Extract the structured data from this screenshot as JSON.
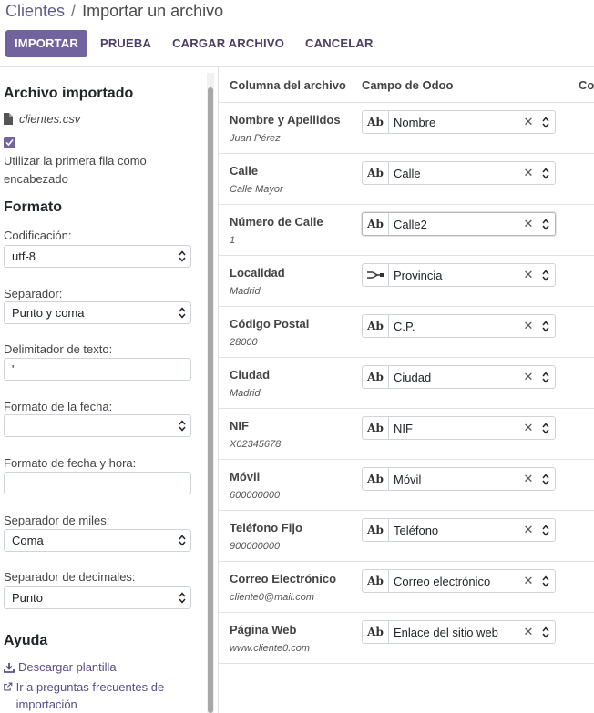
{
  "breadcrumb": {
    "parent": "Clientes",
    "separator": "/",
    "current": "Importar un archivo"
  },
  "toolbar": {
    "import": "IMPORTAR",
    "test": "PRUEBA",
    "load_file": "CARGAR ARCHIVO",
    "cancel": "CANCELAR"
  },
  "sidebar": {
    "imported_title": "Archivo importado",
    "file_name": "clientes.csv",
    "first_row_header_label": "Utilizar la primera fila como encabezado",
    "first_row_header_checked": true,
    "format_title": "Formato",
    "encoding_label": "Codificación:",
    "encoding_value": "utf-8",
    "separator_label": "Separador:",
    "separator_value": "Punto y coma",
    "text_delimiter_label": "Delimitador de texto:",
    "text_delimiter_value": "\"",
    "date_format_label": "Formato de la fecha:",
    "date_format_value": "",
    "datetime_format_label": "Formato de fecha y hora:",
    "datetime_format_value": "",
    "thousands_sep_label": "Separador de miles:",
    "thousands_sep_value": "Coma",
    "decimal_sep_label": "Separador de decimales:",
    "decimal_sep_value": "Punto",
    "help_title": "Ayuda",
    "download_template": "Descargar plantilla",
    "faq_link": "Ir a preguntas frecuentes de importación"
  },
  "table": {
    "headers": {
      "file_column": "Columna del archivo",
      "odoo_field": "Campo de Odoo",
      "comments": "Co"
    },
    "rows": [
      {
        "column": "Nombre y Apellidos",
        "sample": "Juan Pérez",
        "field": "Nombre",
        "type_icon": "text-type-icon",
        "type_label": "Ab"
      },
      {
        "column": "Calle",
        "sample": "Calle Mayor",
        "field": "Calle",
        "type_icon": "text-type-icon",
        "type_label": "Ab"
      },
      {
        "column": "Número de Calle",
        "sample": "1",
        "field": "Calle2",
        "type_icon": "text-type-icon",
        "type_label": "Ab",
        "focused": true
      },
      {
        "column": "Localidad",
        "sample": "Madrid",
        "field": "Provincia",
        "type_icon": "relation-type-icon",
        "type_label": ""
      },
      {
        "column": "Código Postal",
        "sample": "28000",
        "field": "C.P.",
        "type_icon": "text-type-icon",
        "type_label": "Ab"
      },
      {
        "column": "Ciudad",
        "sample": "Madrid",
        "field": "Ciudad",
        "type_icon": "text-type-icon",
        "type_label": "Ab"
      },
      {
        "column": "NIF",
        "sample": "X02345678",
        "field": "NIF",
        "type_icon": "text-type-icon",
        "type_label": "Ab"
      },
      {
        "column": "Móvil",
        "sample": "600000000",
        "field": "Móvil",
        "type_icon": "text-type-icon",
        "type_label": "Ab"
      },
      {
        "column": "Teléfono Fijo",
        "sample": "900000000",
        "field": "Teléfono",
        "type_icon": "text-type-icon",
        "type_label": "Ab"
      },
      {
        "column": "Correo Electrónico",
        "sample": "cliente0@mail.com",
        "field": "Correo electrónico",
        "type_icon": "text-type-icon",
        "type_label": "Ab"
      },
      {
        "column": "Página Web",
        "sample": "www.cliente0.com",
        "field": "Enlace del sitio web",
        "type_icon": "text-type-icon",
        "type_label": "Ab"
      }
    ]
  },
  "colors": {
    "accent": "#71639e",
    "link": "#5a4c8a",
    "border": "#dee2e6"
  }
}
